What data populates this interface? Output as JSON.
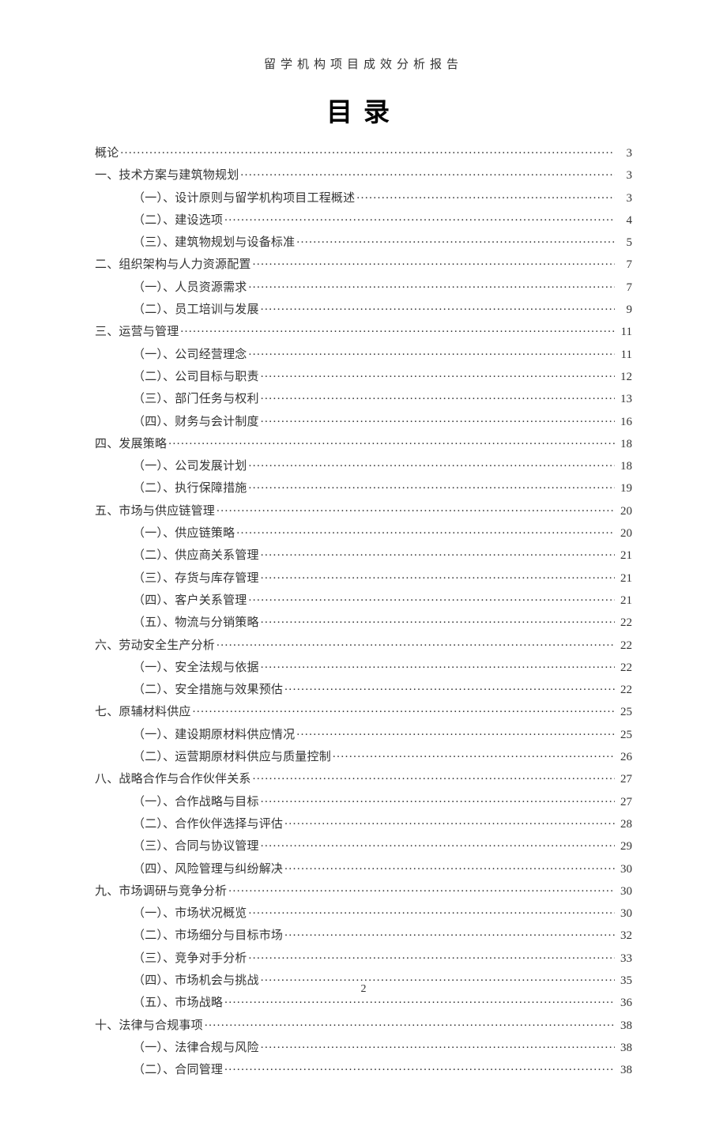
{
  "header": "留学机构项目成效分析报告",
  "title": "目录",
  "page_number": "2",
  "entries": [
    {
      "level": 0,
      "label": "概论",
      "page": "3"
    },
    {
      "level": 0,
      "label": "一、技术方案与建筑物规划",
      "page": "3"
    },
    {
      "level": 1,
      "label": "（一）、设计原则与留学机构项目工程概述",
      "page": "3"
    },
    {
      "level": 1,
      "label": "（二）、建设选项",
      "page": "4"
    },
    {
      "level": 1,
      "label": "（三）、建筑物规划与设备标准",
      "page": "5"
    },
    {
      "level": 0,
      "label": "二、组织架构与人力资源配置",
      "page": "7"
    },
    {
      "level": 1,
      "label": "（一）、人员资源需求",
      "page": "7"
    },
    {
      "level": 1,
      "label": "（二）、员工培训与发展",
      "page": "9"
    },
    {
      "level": 0,
      "label": "三、运营与管理",
      "page": "11"
    },
    {
      "level": 1,
      "label": "（一）、公司经营理念",
      "page": "11"
    },
    {
      "level": 1,
      "label": "（二）、公司目标与职责",
      "page": "12"
    },
    {
      "level": 1,
      "label": "（三）、部门任务与权利",
      "page": "13"
    },
    {
      "level": 1,
      "label": "（四）、财务与会计制度",
      "page": "16"
    },
    {
      "level": 0,
      "label": "四、发展策略",
      "page": "18"
    },
    {
      "level": 1,
      "label": "（一）、公司发展计划",
      "page": "18"
    },
    {
      "level": 1,
      "label": "（二）、执行保障措施",
      "page": "19"
    },
    {
      "level": 0,
      "label": "五、市场与供应链管理",
      "page": "20"
    },
    {
      "level": 1,
      "label": "（一）、供应链策略",
      "page": "20"
    },
    {
      "level": 1,
      "label": "（二）、供应商关系管理",
      "page": "21"
    },
    {
      "level": 1,
      "label": "（三）、存货与库存管理",
      "page": "21"
    },
    {
      "level": 1,
      "label": "（四）、客户关系管理",
      "page": "21"
    },
    {
      "level": 1,
      "label": "（五）、物流与分销策略",
      "page": "22"
    },
    {
      "level": 0,
      "label": "六、劳动安全生产分析",
      "page": "22"
    },
    {
      "level": 1,
      "label": "（一）、安全法规与依据",
      "page": "22"
    },
    {
      "level": 1,
      "label": "（二）、安全措施与效果预估",
      "page": "22"
    },
    {
      "level": 0,
      "label": "七、原辅材料供应",
      "page": "25"
    },
    {
      "level": 1,
      "label": "（一）、建设期原材料供应情况",
      "page": "25"
    },
    {
      "level": 1,
      "label": "（二）、运营期原材料供应与质量控制",
      "page": "26"
    },
    {
      "level": 0,
      "label": "八、战略合作与合作伙伴关系",
      "page": "27"
    },
    {
      "level": 1,
      "label": "（一）、合作战略与目标",
      "page": "27"
    },
    {
      "level": 1,
      "label": "（二）、合作伙伴选择与评估",
      "page": "28"
    },
    {
      "level": 1,
      "label": "（三）、合同与协议管理",
      "page": "29"
    },
    {
      "level": 1,
      "label": "（四）、风险管理与纠纷解决",
      "page": "30"
    },
    {
      "level": 0,
      "label": "九、市场调研与竞争分析",
      "page": "30"
    },
    {
      "level": 1,
      "label": "（一）、市场状况概览",
      "page": "30"
    },
    {
      "level": 1,
      "label": "（二）、市场细分与目标市场",
      "page": "32"
    },
    {
      "level": 1,
      "label": "（三）、竞争对手分析",
      "page": "33"
    },
    {
      "level": 1,
      "label": "（四）、市场机会与挑战",
      "page": "35"
    },
    {
      "level": 1,
      "label": "（五）、市场战略",
      "page": "36"
    },
    {
      "level": 0,
      "label": "十、法律与合规事项",
      "page": "38"
    },
    {
      "level": 1,
      "label": "（一）、法律合规与风险",
      "page": "38"
    },
    {
      "level": 1,
      "label": "（二）、合同管理",
      "page": "38"
    }
  ]
}
